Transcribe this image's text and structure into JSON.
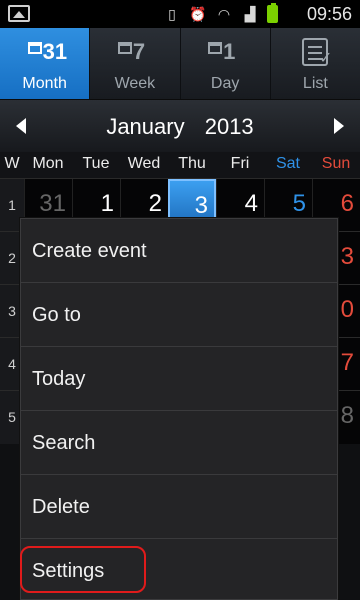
{
  "status_bar": {
    "time": "09:56",
    "icons": [
      "gallery-icon",
      "vibrate-icon",
      "alarm-icon",
      "wifi-icon",
      "signal-icon",
      "battery-icon"
    ],
    "battery_color": "#7bd000"
  },
  "tabs": [
    {
      "label": "Month",
      "icon_number": "31",
      "active": true
    },
    {
      "label": "Week",
      "icon_number": "7",
      "active": false
    },
    {
      "label": "Day",
      "icon_number": "1",
      "active": false
    },
    {
      "label": "List",
      "active": false
    }
  ],
  "month_header": {
    "month": "January",
    "year": "2013"
  },
  "weekdays": [
    "W",
    "Mon",
    "Tue",
    "Wed",
    "Thu",
    "Fri",
    "Sat",
    "Sun"
  ],
  "weeks": [
    {
      "week": "1",
      "days": [
        "31",
        "1",
        "2",
        "3",
        "4",
        "5",
        "6"
      ]
    },
    {
      "week": "2",
      "days": [
        "",
        "",
        "",
        "",
        "",
        "",
        "3"
      ]
    },
    {
      "week": "3",
      "days": [
        "",
        "",
        "",
        "",
        "",
        "",
        "0"
      ]
    },
    {
      "week": "4",
      "days": [
        "",
        "",
        "",
        "",
        "",
        "",
        "7"
      ]
    },
    {
      "week": "5",
      "days": [
        "",
        "",
        "",
        "",
        "",
        "",
        "8"
      ]
    }
  ],
  "menu": {
    "items": [
      "Create event",
      "Go to",
      "Today",
      "Search",
      "Delete",
      "Settings"
    ]
  },
  "colors": {
    "accent": "#1f7fd4",
    "saturday": "#2f92e8",
    "sunday": "#e44b3b",
    "highlight": "#e01b1b"
  }
}
